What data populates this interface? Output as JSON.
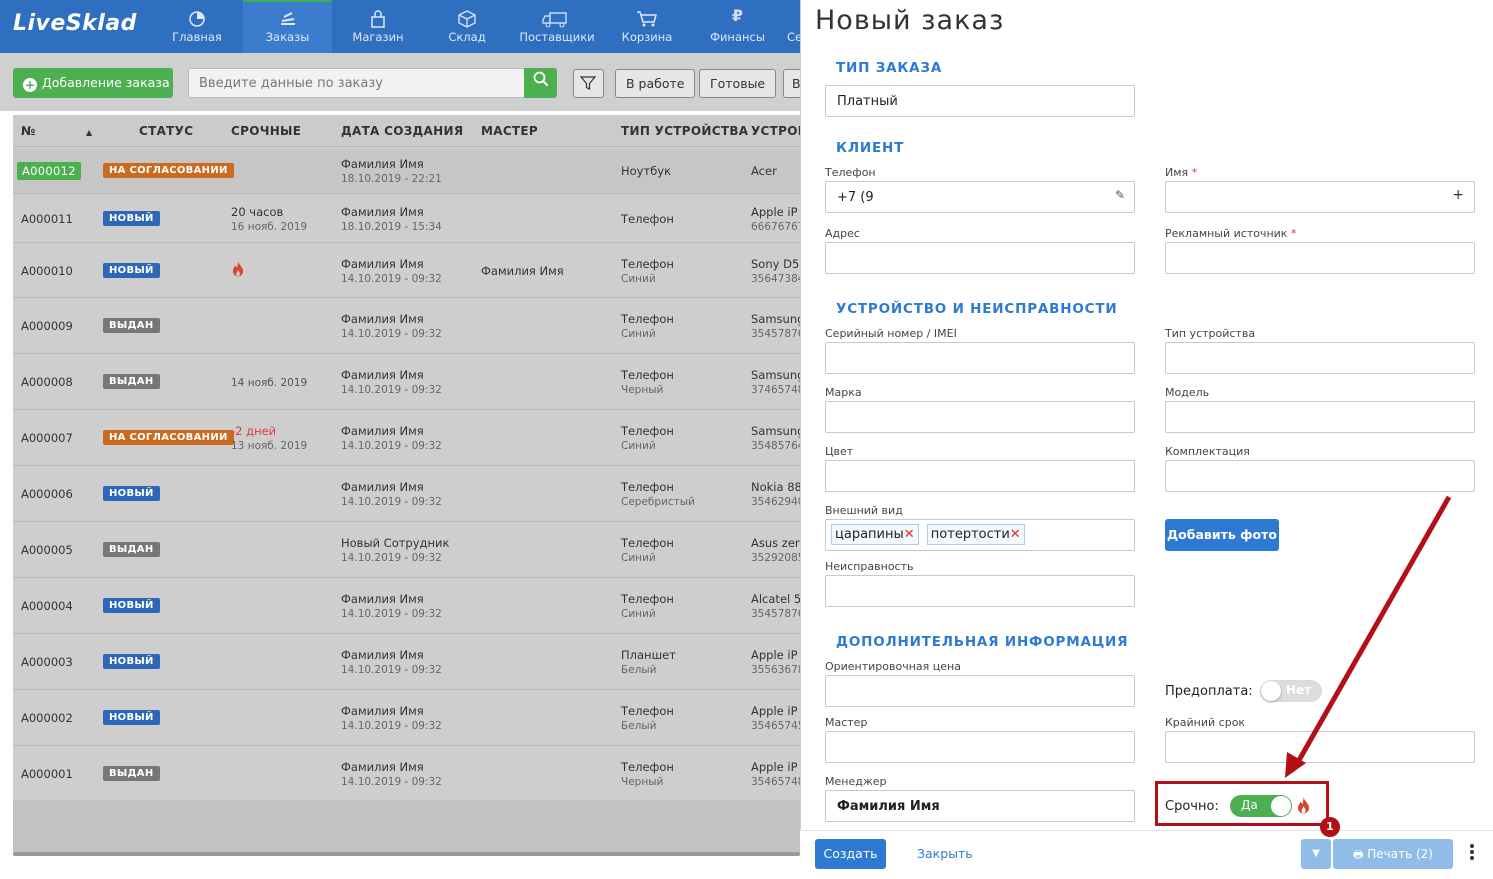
{
  "app": {
    "logo": "LiveSklad"
  },
  "nav": [
    {
      "label": "Главная",
      "icon": "pie-chart-icon"
    },
    {
      "label": "Заказы",
      "icon": "stack-icon",
      "active": true
    },
    {
      "label": "Магазин",
      "icon": "lock-bag-icon"
    },
    {
      "label": "Склад",
      "icon": "box-icon"
    },
    {
      "label": "Поставщики",
      "icon": "truck-icon"
    },
    {
      "label": "Корзина",
      "icon": "cart-icon"
    },
    {
      "label": "Финансы",
      "icon": "ruble-icon"
    },
    {
      "label": "Се",
      "icon": "settings-icon"
    }
  ],
  "toolbar": {
    "add_label": "Добавление заказа",
    "search_placeholder": "Введите данные по заказу",
    "filter_in_work": "В работе",
    "filter_ready": "Готовые",
    "filter_more": "В"
  },
  "table": {
    "headers": {
      "num": "№",
      "status": "СТАТУС",
      "urgent": "СРОЧНЫЕ",
      "created": "ДАТА СОЗДАНИЯ",
      "master": "МАСТЕР",
      "type": "ТИП УСТРОЙСТВА",
      "device": "УСТРОЙ"
    },
    "rows": [
      {
        "num": "A000012",
        "status": "НА СОГЛАСОВАНИИ",
        "urgent": "",
        "urgent_sub": "",
        "author": "Фамилия Имя",
        "date": "18.10.2019 - 22:21",
        "master": "",
        "type": "Ноутбук",
        "type_sub": "",
        "device": "Acer",
        "device_sub": ""
      },
      {
        "num": "A000011",
        "status": "НОВЫЙ",
        "urgent": "20 часов",
        "urgent_sub": "16 нояб. 2019",
        "author": "Фамилия Имя",
        "date": "18.10.2019 - 15:34",
        "master": "",
        "type": "Телефон",
        "type_sub": "",
        "device": "Apple iP",
        "device_sub": "66676767"
      },
      {
        "num": "A000010",
        "status": "НОВЫЙ",
        "urgent": "",
        "urgent_sub": "",
        "author": "Фамилия Имя",
        "date": "14.10.2019 - 09:32",
        "master": "Фамилия Имя",
        "type": "Телефон",
        "type_sub": "Синий",
        "device": "Sony D5",
        "device_sub": "35647384"
      },
      {
        "num": "A000009",
        "status": "ВЫДАН",
        "urgent": "",
        "urgent_sub": "",
        "author": "Фамилия Имя",
        "date": "14.10.2019 - 09:32",
        "master": "",
        "type": "Телефон",
        "type_sub": "Синий",
        "device": "Samsung",
        "device_sub": "35457876"
      },
      {
        "num": "A000008",
        "status": "ВЫДАН",
        "urgent": "14 нояб. 2019",
        "urgent_sub": "",
        "author": "Фамилия Имя",
        "date": "14.10.2019 - 09:32",
        "master": "",
        "type": "Телефон",
        "type_sub": "Черный",
        "device": "Samsung",
        "device_sub": "37465748"
      },
      {
        "num": "A000007",
        "status": "НА СОГЛАСОВАНИИ",
        "urgent": "-2 дней",
        "urgent_sub": "13 нояб. 2019",
        "author": "Фамилия Имя",
        "date": "14.10.2019 - 09:32",
        "master": "",
        "type": "Телефон",
        "type_sub": "Синий",
        "device": "Samsung",
        "device_sub": "35485764"
      },
      {
        "num": "A000006",
        "status": "НОВЫЙ",
        "urgent": "",
        "urgent_sub": "",
        "author": "Фамилия Имя",
        "date": "14.10.2019 - 09:32",
        "master": "",
        "type": "Телефон",
        "type_sub": "Серебристый",
        "device": "Nokia 88",
        "device_sub": "35462940"
      },
      {
        "num": "A000005",
        "status": "ВЫДАН",
        "urgent": "",
        "urgent_sub": "",
        "author": "Новый Сотрудник",
        "date": "14.10.2019 - 09:32",
        "master": "",
        "type": "Телефон",
        "type_sub": "Синий",
        "device": "Asus zer",
        "device_sub": "35292085"
      },
      {
        "num": "A000004",
        "status": "НОВЫЙ",
        "urgent": "",
        "urgent_sub": "",
        "author": "Фамилия Имя",
        "date": "14.10.2019 - 09:32",
        "master": "",
        "type": "Телефон",
        "type_sub": "Синий",
        "device": "Alcatel 5",
        "device_sub": "35457876"
      },
      {
        "num": "A000003",
        "status": "НОВЫЙ",
        "urgent": "",
        "urgent_sub": "",
        "author": "Фамилия Имя",
        "date": "14.10.2019 - 09:32",
        "master": "",
        "type": "Планшет",
        "type_sub": "Белый",
        "device": "Apple iP",
        "device_sub": "35563678"
      },
      {
        "num": "A000002",
        "status": "НОВЫЙ",
        "urgent": "",
        "urgent_sub": "",
        "author": "Фамилия Имя",
        "date": "14.10.2019 - 09:32",
        "master": "",
        "type": "Телефон",
        "type_sub": "Белый",
        "device": "Apple iP",
        "device_sub": "35465745"
      },
      {
        "num": "A000001",
        "status": "ВЫДАН",
        "urgent": "",
        "urgent_sub": "",
        "author": "Фамилия Имя",
        "date": "14.10.2019 - 09:32",
        "master": "",
        "type": "Телефон",
        "type_sub": "Черный",
        "device": "Apple iP",
        "device_sub": "35465748"
      }
    ]
  },
  "panel": {
    "title": "Новый заказ",
    "sections": {
      "order_type": "ТИП ЗАКАЗА",
      "client": "КЛИЕНТ",
      "device": "УСТРОЙСТВО И НЕИСПРАВНОСТИ",
      "extra": "ДОПОЛНИТЕЛЬНАЯ ИНФОРМАЦИЯ"
    },
    "order_type_value": "Платный",
    "labels": {
      "phone": "Телефон",
      "name": "Имя",
      "address": "Адрес",
      "ad_source": "Рекламный источник",
      "serial": "Серийный номер / IMEI",
      "device_type": "Тип устройства",
      "brand": "Марка",
      "model": "Модель",
      "color": "Цвет",
      "kit": "Комплектация",
      "appearance": "Внешний вид",
      "fault": "Неисправность",
      "price": "Ориентировочная цена",
      "prepay": "Предоплата:",
      "master": "Мастер",
      "deadline": "Крайний срок",
      "manager": "Менеджер",
      "urgent": "Срочно:"
    },
    "required_mark": "*",
    "phone_value": "+7 (9",
    "name_add": "+",
    "appearance_tags": [
      "царапины",
      "потертости"
    ],
    "tag_remove": "✕",
    "add_photo": "Добавить фото",
    "prepay_toggle": "Нет",
    "urgent_toggle": "Да",
    "manager_value": "Фамилия Имя",
    "footer": {
      "create": "Создать",
      "close": "Закрыть",
      "print": "Печать (2)"
    },
    "annotation_number": "1"
  },
  "colors": {
    "accent": "#2e7ad3",
    "nav": "#2f6fc0",
    "green": "#4caf50",
    "annotation": "#b30f16"
  }
}
